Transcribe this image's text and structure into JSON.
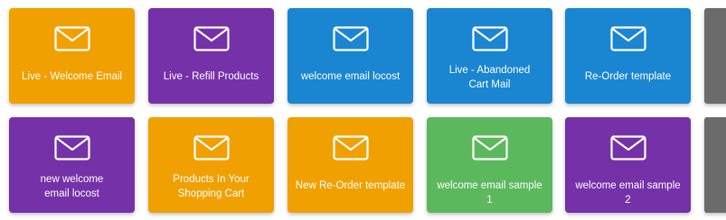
{
  "colors": {
    "orange": "#f0a000",
    "purple": "#7431a8",
    "blue": "#1a85d0",
    "green": "#5cb85c",
    "gray": "#6b6b6b"
  },
  "rows": [
    [
      {
        "label": "Live - Welcome Email",
        "color": "#f0a000",
        "icon": "envelope-icon"
      },
      {
        "label": "Live - Refill Products",
        "color": "#7431a8",
        "icon": "envelope-icon"
      },
      {
        "label": "welcome email locost",
        "color": "#1a85d0",
        "icon": "envelope-icon"
      },
      {
        "label": "Live - Abandoned Cart Mail",
        "color": "#1a85d0",
        "icon": "envelope-icon"
      },
      {
        "label": "Re-Order template",
        "color": "#1a85d0",
        "icon": "envelope-icon"
      }
    ],
    [
      {
        "label": "new welcome email locost",
        "color": "#7431a8",
        "icon": "envelope-icon"
      },
      {
        "label": "Products In Your Shopping Cart",
        "color": "#f0a000",
        "icon": "envelope-icon"
      },
      {
        "label": "New Re-Order template",
        "color": "#f0a000",
        "icon": "envelope-icon"
      },
      {
        "label": "welcome email sample 1",
        "color": "#5cb85c",
        "icon": "envelope-icon"
      },
      {
        "label": "welcome email sample 2",
        "color": "#7431a8",
        "icon": "envelope-icon"
      }
    ]
  ]
}
